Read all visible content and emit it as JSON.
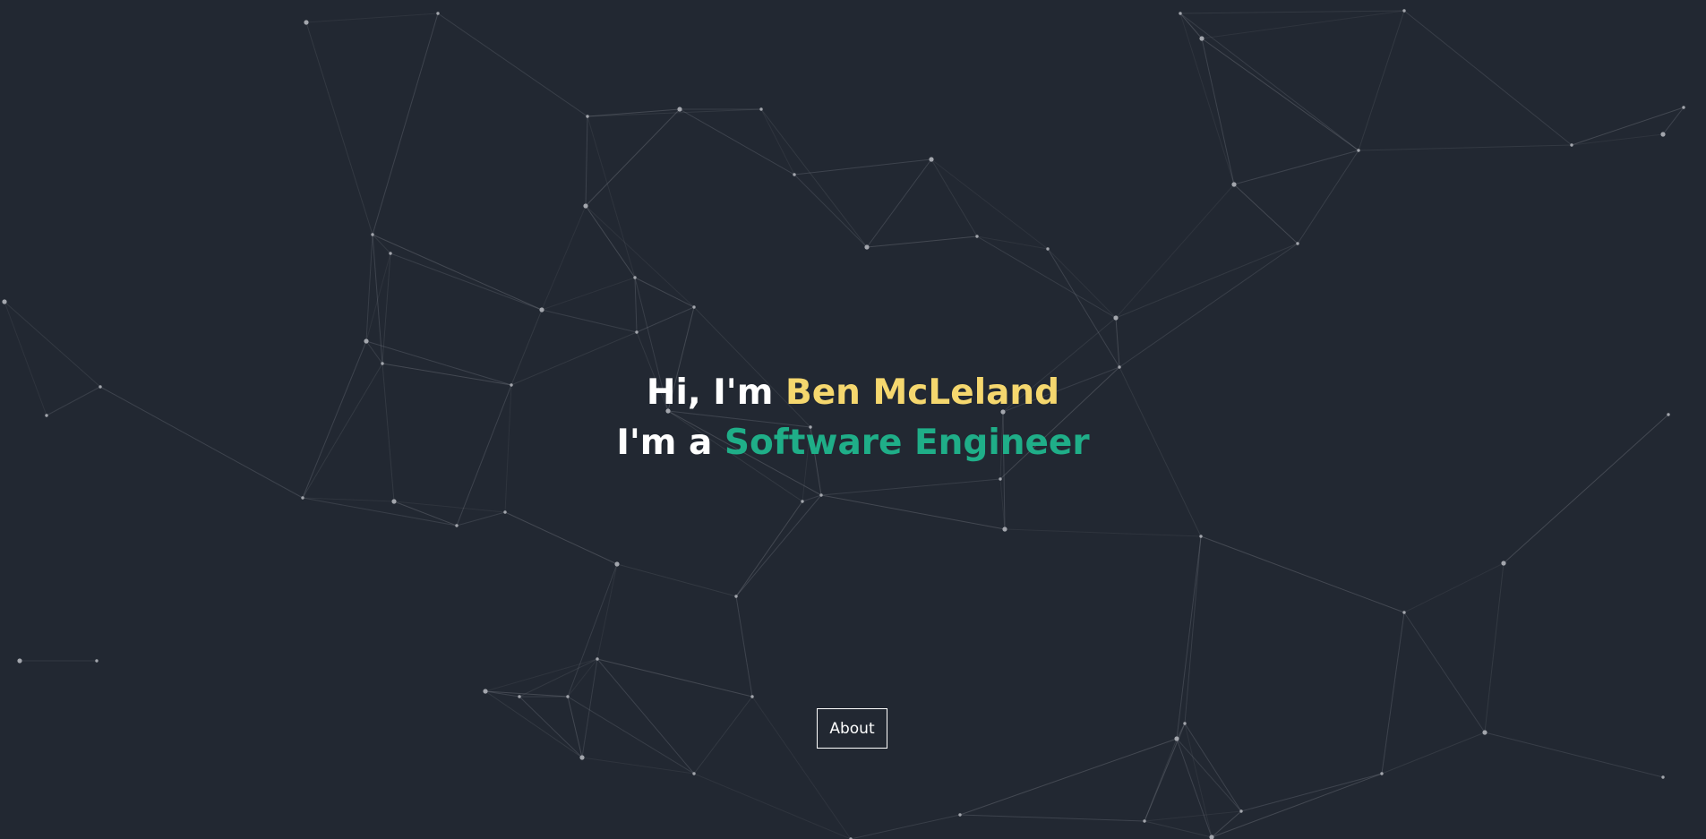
{
  "hero": {
    "greeting_prefix": "Hi, I'm ",
    "name": "Ben McLeland",
    "role_prefix": "I'm a ",
    "role": "Software Engineer"
  },
  "nav": {
    "about_label": "About"
  },
  "colors": {
    "background": "#222832",
    "name_accent": "#f5d76e",
    "role_accent": "#1fae88",
    "network_lines": "#8a8d96",
    "network_nodes": "#a3a6ad"
  }
}
